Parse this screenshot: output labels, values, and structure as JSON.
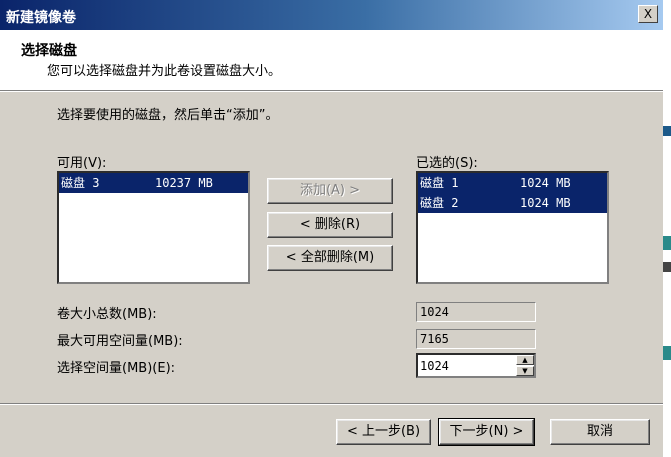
{
  "window": {
    "title": "新建镜像卷",
    "close_glyph": "X"
  },
  "header": {
    "title": "选择磁盘",
    "subtitle": "您可以选择磁盘并为此卷设置磁盘大小。"
  },
  "instruction": "选择要使用的磁盘，然后单击“添加”。",
  "available": {
    "label": "可用(V):",
    "items": [
      {
        "disk": "磁盘 3",
        "size": "10237 MB",
        "selected": true
      }
    ]
  },
  "selected": {
    "label": "已选的(S):",
    "items": [
      {
        "disk": "磁盘 1",
        "size": "1024 MB",
        "selected": true
      },
      {
        "disk": "磁盘 2",
        "size": "1024 MB",
        "selected": true
      }
    ]
  },
  "buttons": {
    "add": "添加(A) >",
    "remove": "< 删除(R)",
    "remove_all": "< 全部删除(M)",
    "back": "< 上一步(B)",
    "next": "下一步(N) >",
    "cancel": "取消"
  },
  "fields": {
    "total_label": "卷大小总数(MB):",
    "total_value": "1024",
    "max_label": "最大可用空间量(MB):",
    "max_value": "7165",
    "space_label": "选择空间量(MB)(E):",
    "space_value": "1024"
  },
  "colors": {
    "selection": "#0a246a",
    "dialog_bg": "#d4d0c8"
  }
}
